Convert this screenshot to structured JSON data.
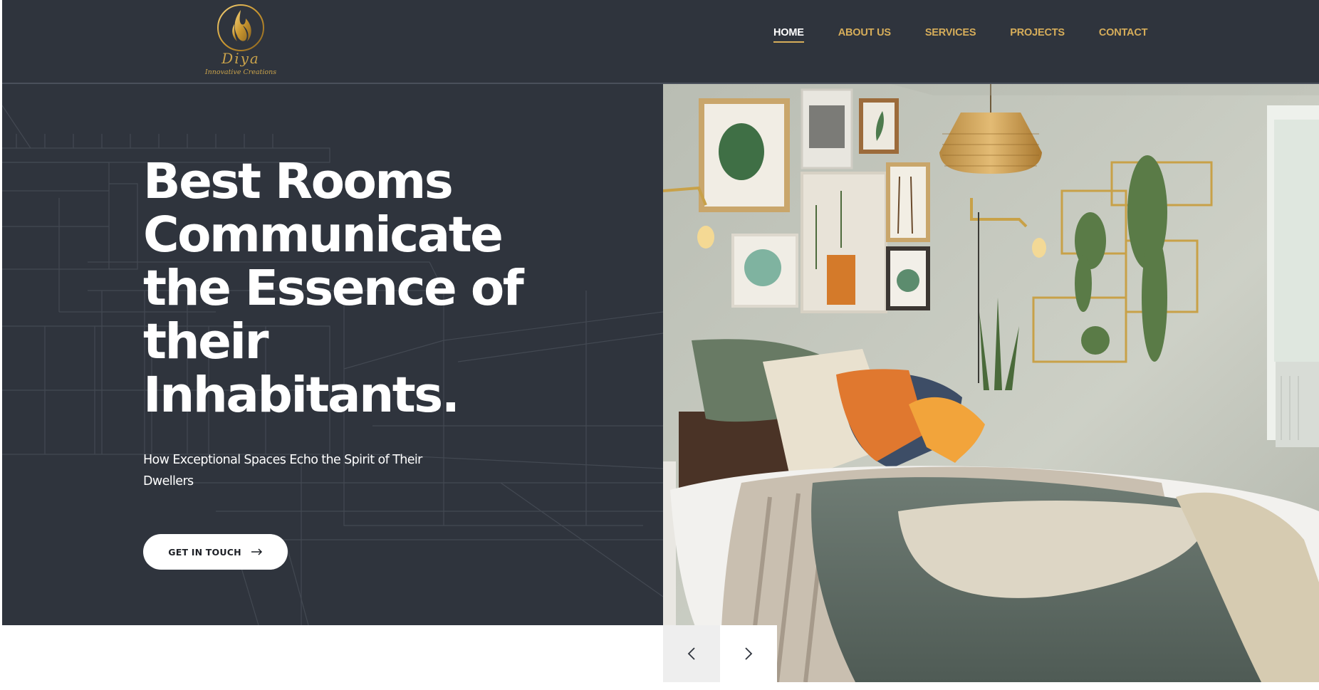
{
  "brand": {
    "name": "Diya",
    "tagline": "Innovative Creations",
    "logo_icon": "flame-emblem-icon",
    "accent_color": "#d6ad5a"
  },
  "nav": {
    "items": [
      {
        "label": "HOME",
        "active": true
      },
      {
        "label": "ABOUT US",
        "active": false
      },
      {
        "label": "SERVICES",
        "active": false
      },
      {
        "label": "PROJECTS",
        "active": false
      },
      {
        "label": "CONTACT",
        "active": false
      }
    ]
  },
  "hero": {
    "title": "Best Rooms Communicate the Essence of their Inhabitants.",
    "subtitle": "How Exceptional Spaces Echo the Spirit of Their Dwellers",
    "cta_label": "GET IN TOUCH",
    "cta_icon": "arrow-right-icon",
    "background_color": "#2f343d"
  },
  "slider": {
    "prev_icon": "chevron-left-icon",
    "next_icon": "chevron-right-icon"
  }
}
